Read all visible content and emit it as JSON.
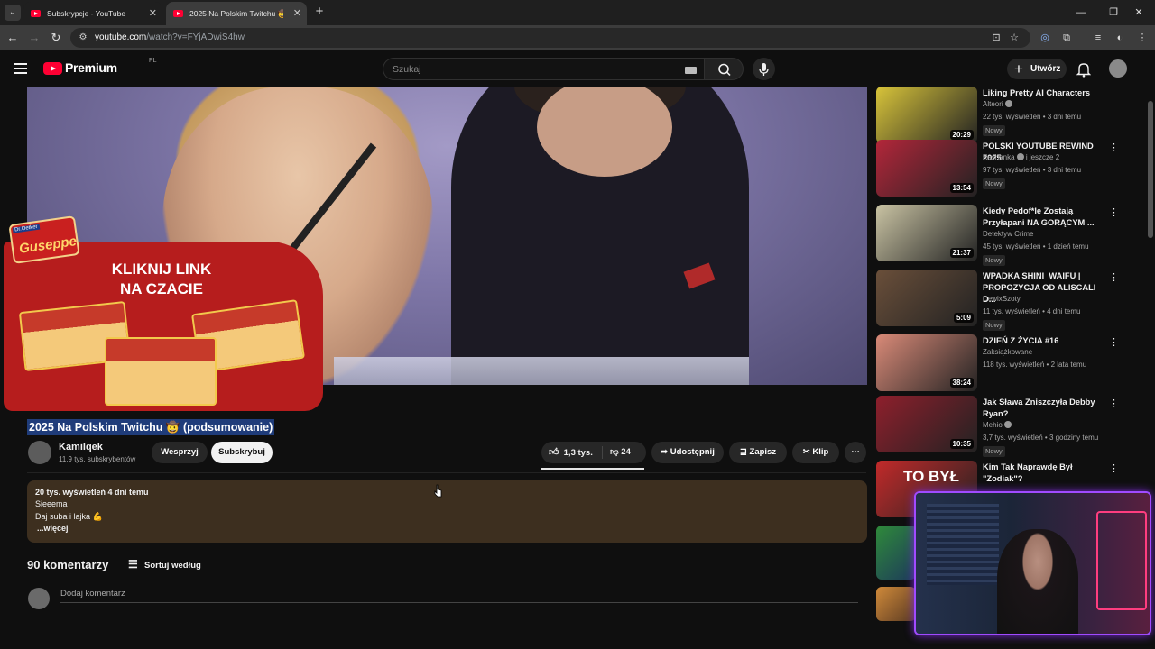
{
  "browser": {
    "tabs": [
      {
        "label": "Subskrypcje - YouTube",
        "active": false
      },
      {
        "label": "2025 Na Polskim Twitchu 🤠 (p",
        "active": true
      }
    ],
    "url_domain": "youtube.com",
    "url_path": "/watch?v=FYjADwiS4hw"
  },
  "header": {
    "logo_text": "Premium",
    "country_code": "PL",
    "search_placeholder": "Szukaj",
    "create_label": "Utwórz"
  },
  "video": {
    "promo_headline_1": "KLIKNIJ LINK",
    "promo_headline_2": "NA CZACIE",
    "promo_brand": "Guseppe",
    "promo_maker": "Dr.Oetker",
    "title": "2025 Na Polskim Twitchu 🤠 (podsumowanie)"
  },
  "channel": {
    "name": "Kamilqek",
    "subscribers": "11,9 tys. subskrybentów",
    "support_label": "Wesprzyj",
    "subscribe_label": "Subskrybuj"
  },
  "actions": {
    "likes": "1,3 tys.",
    "dislikes": "24",
    "share_label": "Udostępnij",
    "save_label": "Zapisz",
    "clip_label": "Klip"
  },
  "description": {
    "meta": "20 tys. wyświetleń  4 dni temu",
    "line1": "Sieeema",
    "line2": "Daj suba i lajka 💪",
    "more": "...więcej"
  },
  "comments": {
    "count_label": "90 komentarzy",
    "sort_label": "Sortuj według",
    "add_placeholder": "Dodaj komentarz"
  },
  "recommendations": [
    {
      "title": "Liking Pretty AI Characters",
      "channel": "Alteori",
      "verified": true,
      "meta": "22 tys. wyświetleń • 3 dni temu",
      "badge": "Nowy",
      "duration": "20:29",
      "thumb_color": "#d8c43a"
    },
    {
      "title": "POLSKI YOUTUBE REWIND 2025",
      "channel": "Kashanka",
      "channel_suffix": "i jeszcze 2",
      "verified": true,
      "meta": "97 tys. wyświetleń • 3 dni temu",
      "badge": "Nowy",
      "duration": "13:54",
      "thumb_color": "#b3263a"
    },
    {
      "title": "Kiedy Pedof*le Zostają Przyłapani NA GORĄCYM ...",
      "channel": "Detektyw Crime",
      "verified": false,
      "meta": "45 tys. wyświetleń • 1 dzień temu",
      "badge": "Nowy",
      "duration": "21:37",
      "thumb_color": "#c9c3a3"
    },
    {
      "title": "WPADKA SHINI_WAIFU | PROPOZYCJA OD ALISCALI D...",
      "channel": "CewixSzoty",
      "verified": false,
      "meta": "11 tys. wyświetleń • 4 dni temu",
      "badge": "Nowy",
      "duration": "5:09",
      "thumb_color": "#6a4f3a"
    },
    {
      "title": "DZIEŃ Z ŻYCIA #16",
      "channel": "Zaksiążkowane",
      "verified": false,
      "meta": "118 tys. wyświetleń • 2 lata temu",
      "badge": "",
      "duration": "38:24",
      "thumb_color": "#d98a78"
    },
    {
      "title": "Jak Sława Zniszczyła Debby Ryan?",
      "channel": "Mehio",
      "verified": true,
      "meta": "3,7 tys. wyświetleń • 3 godziny temu",
      "badge": "Nowy",
      "duration": "10:35",
      "thumb_color": "#8e1f2c"
    },
    {
      "title": "Kim Tak Naprawdę Był \"Zodiak\"?",
      "channel": "",
      "verified": false,
      "meta": "",
      "badge": "",
      "duration": "",
      "thumb_color": "#c22a2a",
      "thumb_text": "TO BYŁ"
    }
  ]
}
